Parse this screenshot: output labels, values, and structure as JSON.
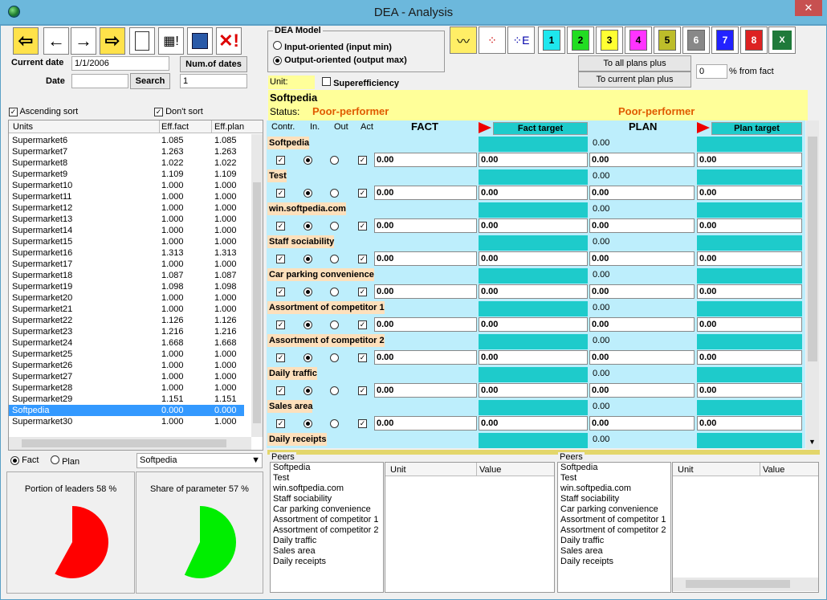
{
  "window": {
    "title": "DEA - Analysis",
    "close": "✕"
  },
  "toolbar": {
    "numbers": [
      "1",
      "2",
      "3",
      "4",
      "5",
      "6",
      "7",
      "8"
    ],
    "number_colors": [
      "#1ee7ee",
      "#22dd22",
      "#ffff33",
      "#ff33ff",
      "#bdbd2a",
      "#888888",
      "#2222ff",
      "#dd2222"
    ]
  },
  "controls": {
    "current_date_label": "Current date",
    "current_date": "1/1/2006",
    "num_dates_button": "Num.of dates",
    "date_label": "Date",
    "date_value": "",
    "search_button": "Search",
    "num_dates_value": "1",
    "ascending_sort": "Ascending sort",
    "dont_sort": "Don't sort"
  },
  "dea_model": {
    "title": "DEA Model",
    "option1": "Input-oriented (input min)",
    "option2": "Output-oriented (output max)",
    "selected": "Output-oriented (output max)"
  },
  "plans": {
    "all_plans": "To all plans plus",
    "current_plan": "To current plan plus",
    "percent": "0",
    "percent_label": "% from fact"
  },
  "units_list": {
    "headers": [
      "Units",
      "Eff.fact",
      "Eff.plan"
    ],
    "rows": [
      [
        "Supermarket6",
        "1.085",
        "1.085"
      ],
      [
        "Supermarket7",
        "1.263",
        "1.263"
      ],
      [
        "Supermarket8",
        "1.022",
        "1.022"
      ],
      [
        "Supermarket9",
        "1.109",
        "1.109"
      ],
      [
        "Supermarket10",
        "1.000",
        "1.000"
      ],
      [
        "Supermarket11",
        "1.000",
        "1.000"
      ],
      [
        "Supermarket12",
        "1.000",
        "1.000"
      ],
      [
        "Supermarket13",
        "1.000",
        "1.000"
      ],
      [
        "Supermarket14",
        "1.000",
        "1.000"
      ],
      [
        "Supermarket15",
        "1.000",
        "1.000"
      ],
      [
        "Supermarket16",
        "1.313",
        "1.313"
      ],
      [
        "Supermarket17",
        "1.000",
        "1.000"
      ],
      [
        "Supermarket18",
        "1.087",
        "1.087"
      ],
      [
        "Supermarket19",
        "1.098",
        "1.098"
      ],
      [
        "Supermarket20",
        "1.000",
        "1.000"
      ],
      [
        "Supermarket21",
        "1.000",
        "1.000"
      ],
      [
        "Supermarket22",
        "1.126",
        "1.126"
      ],
      [
        "Supermarket23",
        "1.216",
        "1.216"
      ],
      [
        "Supermarket24",
        "1.668",
        "1.668"
      ],
      [
        "Supermarket25",
        "1.000",
        "1.000"
      ],
      [
        "Supermarket26",
        "1.000",
        "1.000"
      ],
      [
        "Supermarket27",
        "1.000",
        "1.000"
      ],
      [
        "Supermarket28",
        "1.000",
        "1.000"
      ],
      [
        "Supermarket29",
        "1.151",
        "1.151"
      ],
      [
        "Softpedia",
        "0.000",
        "0.000"
      ],
      [
        "Supermarket30",
        "1.000",
        "1.000"
      ]
    ],
    "selected": "Softpedia"
  },
  "unit_panel": {
    "unit_label": "Unit:",
    "superefficiency": "Superefficiency",
    "unit_name": "Softpedia",
    "status_label": "Status:",
    "status_fact": "Poor-performer",
    "status_plan": "Poor-performer"
  },
  "grid": {
    "headers": {
      "contr": "Contr.",
      "in": "In.",
      "out": "Out",
      "act": "Act",
      "fact": "FACT",
      "fact_target": "Fact target",
      "plan": "PLAN",
      "plan_target": "Plan target"
    },
    "rows": [
      {
        "name": "Softpedia",
        "value": "0.00",
        "plan_top": "0.00"
      },
      {
        "name": "Test",
        "value": "0.00",
        "plan_top": "0.00"
      },
      {
        "name": "win.softpedia.com",
        "value": "0.00",
        "plan_top": "0.00"
      },
      {
        "name": "Staff sociability",
        "value": "0.00",
        "plan_top": "0.00"
      },
      {
        "name": "Car parking convenience",
        "value": "0.00",
        "plan_top": "0.00"
      },
      {
        "name": "Assortment of competitor 1",
        "value": "0.00",
        "plan_top": "0.00"
      },
      {
        "name": "Assortment of competitor 2",
        "value": "0.00",
        "plan_top": "0.00"
      },
      {
        "name": "Daily traffic",
        "value": "0.00",
        "plan_top": "0.00"
      },
      {
        "name": "Sales area",
        "value": "0.00",
        "plan_top": "0.00"
      },
      {
        "name": "Daily receipts",
        "value": "",
        "plan_top": "0.00"
      }
    ]
  },
  "bottom": {
    "fact": "Fact",
    "plan": "Plan",
    "combo": "Softpedia",
    "portion_leaders": "Portion of leaders 58 %",
    "share_param": "Share of parameter 57 %",
    "leaders_fraction": 0.58,
    "share_fraction": 0.57
  },
  "peers": {
    "title": "Peers",
    "unit_col": "Unit",
    "value_col": "Value",
    "items": [
      "Softpedia",
      "Test",
      "win.softpedia.com",
      "Staff sociability",
      "Car parking convenience",
      "Assortment of competitor 1",
      "Assortment of competitor 2",
      "Daily traffic",
      "Sales area",
      "Daily receipts"
    ]
  }
}
